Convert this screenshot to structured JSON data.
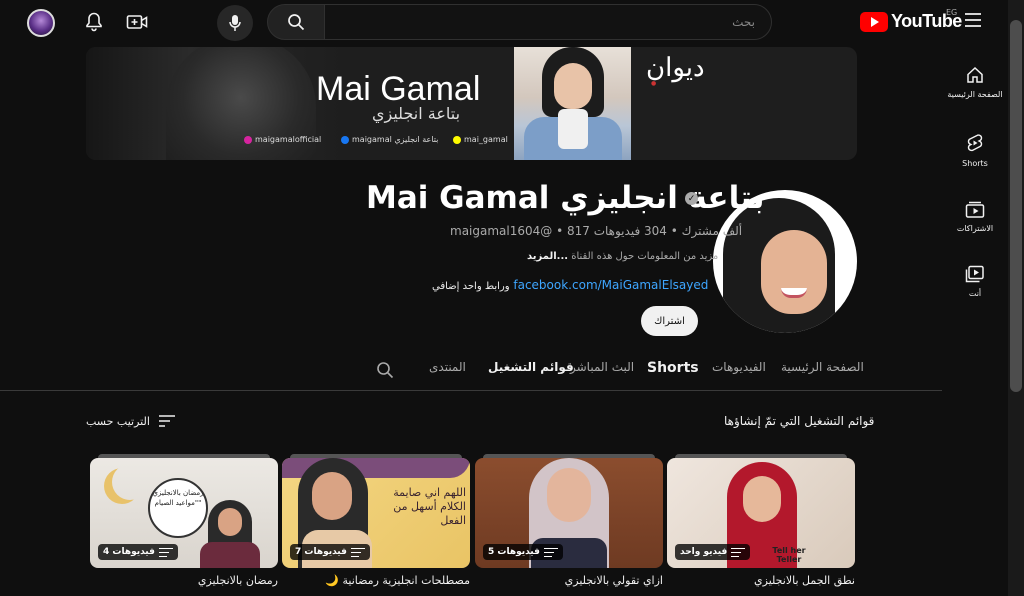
{
  "header": {
    "search_placeholder": "بحث",
    "logo_text": "YouTube",
    "country_code": "EG"
  },
  "sidebar": {
    "items": [
      {
        "label": "الصفحة الرئيسية",
        "icon": "home-icon"
      },
      {
        "label": "Shorts",
        "icon": "shorts-icon"
      },
      {
        "label": "الاشتراكات",
        "icon": "subscriptions-icon"
      },
      {
        "label": "أنت",
        "icon": "you-icon"
      }
    ]
  },
  "banner": {
    "title": "Mai Gamal",
    "subtitle": "بتاعة انجليزي",
    "brand_logo": "ديوان",
    "social": [
      {
        "text": "maigamalofficial",
        "icon": "instagram-icon"
      },
      {
        "text": "maigamal بتاعة انجليزي",
        "icon": "facebook-icon"
      },
      {
        "text": "mai_gamal",
        "icon": "snapchat-icon"
      }
    ]
  },
  "channel": {
    "name": "Mai Gamal بتاعة انجليزي",
    "meta": "maigamal1604@ • 817 ألف مشترك • 304 فيديوهات",
    "description": "مزيد من المعلومات حول هذه القناة",
    "description_more": "...المزيد",
    "link_url": "facebook.com/MaiGamalElsayed",
    "link_more": "ورابط واحد إضافي",
    "subscribe_label": "اشتراك"
  },
  "tabs": [
    {
      "label": "الصفحة الرئيسية",
      "active": false
    },
    {
      "label": "الفيديوهات",
      "active": false
    },
    {
      "label": "Shorts",
      "active": false
    },
    {
      "label": "البث المباشر",
      "active": false
    },
    {
      "label": "قوائم التشغيل",
      "active": true
    },
    {
      "label": "المنتدى",
      "active": false
    }
  ],
  "section": {
    "title": "قوائم التشغيل التي تمّ إنشاؤها",
    "sort_label": "الترتيب حسب"
  },
  "playlists": [
    {
      "title": "نطق الجمل بالانجليزي",
      "count": "فيديو واحد",
      "thumb_text": "Tell her Teller"
    },
    {
      "title": "ازاي تقولي بالانجليزي",
      "count": "5 فيديوهات",
      "thumb_text": ""
    },
    {
      "title": "🌙 مصطلحات انجليزية رمضانية",
      "count": "7 فيديوهات",
      "thumb_text": "اللهم اني صايمة الكلام أسهل من الفعل"
    },
    {
      "title": "رمضان بالانجليزي",
      "count": "4 فيديوهات",
      "thumb_text": "رمضان بالانجليزي \"مواعيد الصيام\""
    }
  ],
  "colors": {
    "background": "#0f0f0f",
    "link": "#3ea6ff",
    "brand_red": "#ff0000"
  }
}
